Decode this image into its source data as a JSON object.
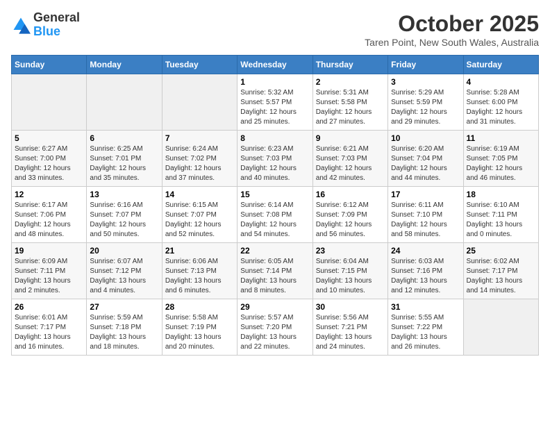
{
  "header": {
    "logo_line1": "General",
    "logo_line2": "Blue",
    "month": "October 2025",
    "location": "Taren Point, New South Wales, Australia"
  },
  "days_of_week": [
    "Sunday",
    "Monday",
    "Tuesday",
    "Wednesday",
    "Thursday",
    "Friday",
    "Saturday"
  ],
  "weeks": [
    [
      {
        "num": "",
        "info": ""
      },
      {
        "num": "",
        "info": ""
      },
      {
        "num": "",
        "info": ""
      },
      {
        "num": "1",
        "info": "Sunrise: 5:32 AM\nSunset: 5:57 PM\nDaylight: 12 hours\nand 25 minutes."
      },
      {
        "num": "2",
        "info": "Sunrise: 5:31 AM\nSunset: 5:58 PM\nDaylight: 12 hours\nand 27 minutes."
      },
      {
        "num": "3",
        "info": "Sunrise: 5:29 AM\nSunset: 5:59 PM\nDaylight: 12 hours\nand 29 minutes."
      },
      {
        "num": "4",
        "info": "Sunrise: 5:28 AM\nSunset: 6:00 PM\nDaylight: 12 hours\nand 31 minutes."
      }
    ],
    [
      {
        "num": "5",
        "info": "Sunrise: 6:27 AM\nSunset: 7:00 PM\nDaylight: 12 hours\nand 33 minutes."
      },
      {
        "num": "6",
        "info": "Sunrise: 6:25 AM\nSunset: 7:01 PM\nDaylight: 12 hours\nand 35 minutes."
      },
      {
        "num": "7",
        "info": "Sunrise: 6:24 AM\nSunset: 7:02 PM\nDaylight: 12 hours\nand 37 minutes."
      },
      {
        "num": "8",
        "info": "Sunrise: 6:23 AM\nSunset: 7:03 PM\nDaylight: 12 hours\nand 40 minutes."
      },
      {
        "num": "9",
        "info": "Sunrise: 6:21 AM\nSunset: 7:03 PM\nDaylight: 12 hours\nand 42 minutes."
      },
      {
        "num": "10",
        "info": "Sunrise: 6:20 AM\nSunset: 7:04 PM\nDaylight: 12 hours\nand 44 minutes."
      },
      {
        "num": "11",
        "info": "Sunrise: 6:19 AM\nSunset: 7:05 PM\nDaylight: 12 hours\nand 46 minutes."
      }
    ],
    [
      {
        "num": "12",
        "info": "Sunrise: 6:17 AM\nSunset: 7:06 PM\nDaylight: 12 hours\nand 48 minutes."
      },
      {
        "num": "13",
        "info": "Sunrise: 6:16 AM\nSunset: 7:07 PM\nDaylight: 12 hours\nand 50 minutes."
      },
      {
        "num": "14",
        "info": "Sunrise: 6:15 AM\nSunset: 7:07 PM\nDaylight: 12 hours\nand 52 minutes."
      },
      {
        "num": "15",
        "info": "Sunrise: 6:14 AM\nSunset: 7:08 PM\nDaylight: 12 hours\nand 54 minutes."
      },
      {
        "num": "16",
        "info": "Sunrise: 6:12 AM\nSunset: 7:09 PM\nDaylight: 12 hours\nand 56 minutes."
      },
      {
        "num": "17",
        "info": "Sunrise: 6:11 AM\nSunset: 7:10 PM\nDaylight: 12 hours\nand 58 minutes."
      },
      {
        "num": "18",
        "info": "Sunrise: 6:10 AM\nSunset: 7:11 PM\nDaylight: 13 hours\nand 0 minutes."
      }
    ],
    [
      {
        "num": "19",
        "info": "Sunrise: 6:09 AM\nSunset: 7:11 PM\nDaylight: 13 hours\nand 2 minutes."
      },
      {
        "num": "20",
        "info": "Sunrise: 6:07 AM\nSunset: 7:12 PM\nDaylight: 13 hours\nand 4 minutes."
      },
      {
        "num": "21",
        "info": "Sunrise: 6:06 AM\nSunset: 7:13 PM\nDaylight: 13 hours\nand 6 minutes."
      },
      {
        "num": "22",
        "info": "Sunrise: 6:05 AM\nSunset: 7:14 PM\nDaylight: 13 hours\nand 8 minutes."
      },
      {
        "num": "23",
        "info": "Sunrise: 6:04 AM\nSunset: 7:15 PM\nDaylight: 13 hours\nand 10 minutes."
      },
      {
        "num": "24",
        "info": "Sunrise: 6:03 AM\nSunset: 7:16 PM\nDaylight: 13 hours\nand 12 minutes."
      },
      {
        "num": "25",
        "info": "Sunrise: 6:02 AM\nSunset: 7:17 PM\nDaylight: 13 hours\nand 14 minutes."
      }
    ],
    [
      {
        "num": "26",
        "info": "Sunrise: 6:01 AM\nSunset: 7:17 PM\nDaylight: 13 hours\nand 16 minutes."
      },
      {
        "num": "27",
        "info": "Sunrise: 5:59 AM\nSunset: 7:18 PM\nDaylight: 13 hours\nand 18 minutes."
      },
      {
        "num": "28",
        "info": "Sunrise: 5:58 AM\nSunset: 7:19 PM\nDaylight: 13 hours\nand 20 minutes."
      },
      {
        "num": "29",
        "info": "Sunrise: 5:57 AM\nSunset: 7:20 PM\nDaylight: 13 hours\nand 22 minutes."
      },
      {
        "num": "30",
        "info": "Sunrise: 5:56 AM\nSunset: 7:21 PM\nDaylight: 13 hours\nand 24 minutes."
      },
      {
        "num": "31",
        "info": "Sunrise: 5:55 AM\nSunset: 7:22 PM\nDaylight: 13 hours\nand 26 minutes."
      },
      {
        "num": "",
        "info": ""
      }
    ]
  ]
}
